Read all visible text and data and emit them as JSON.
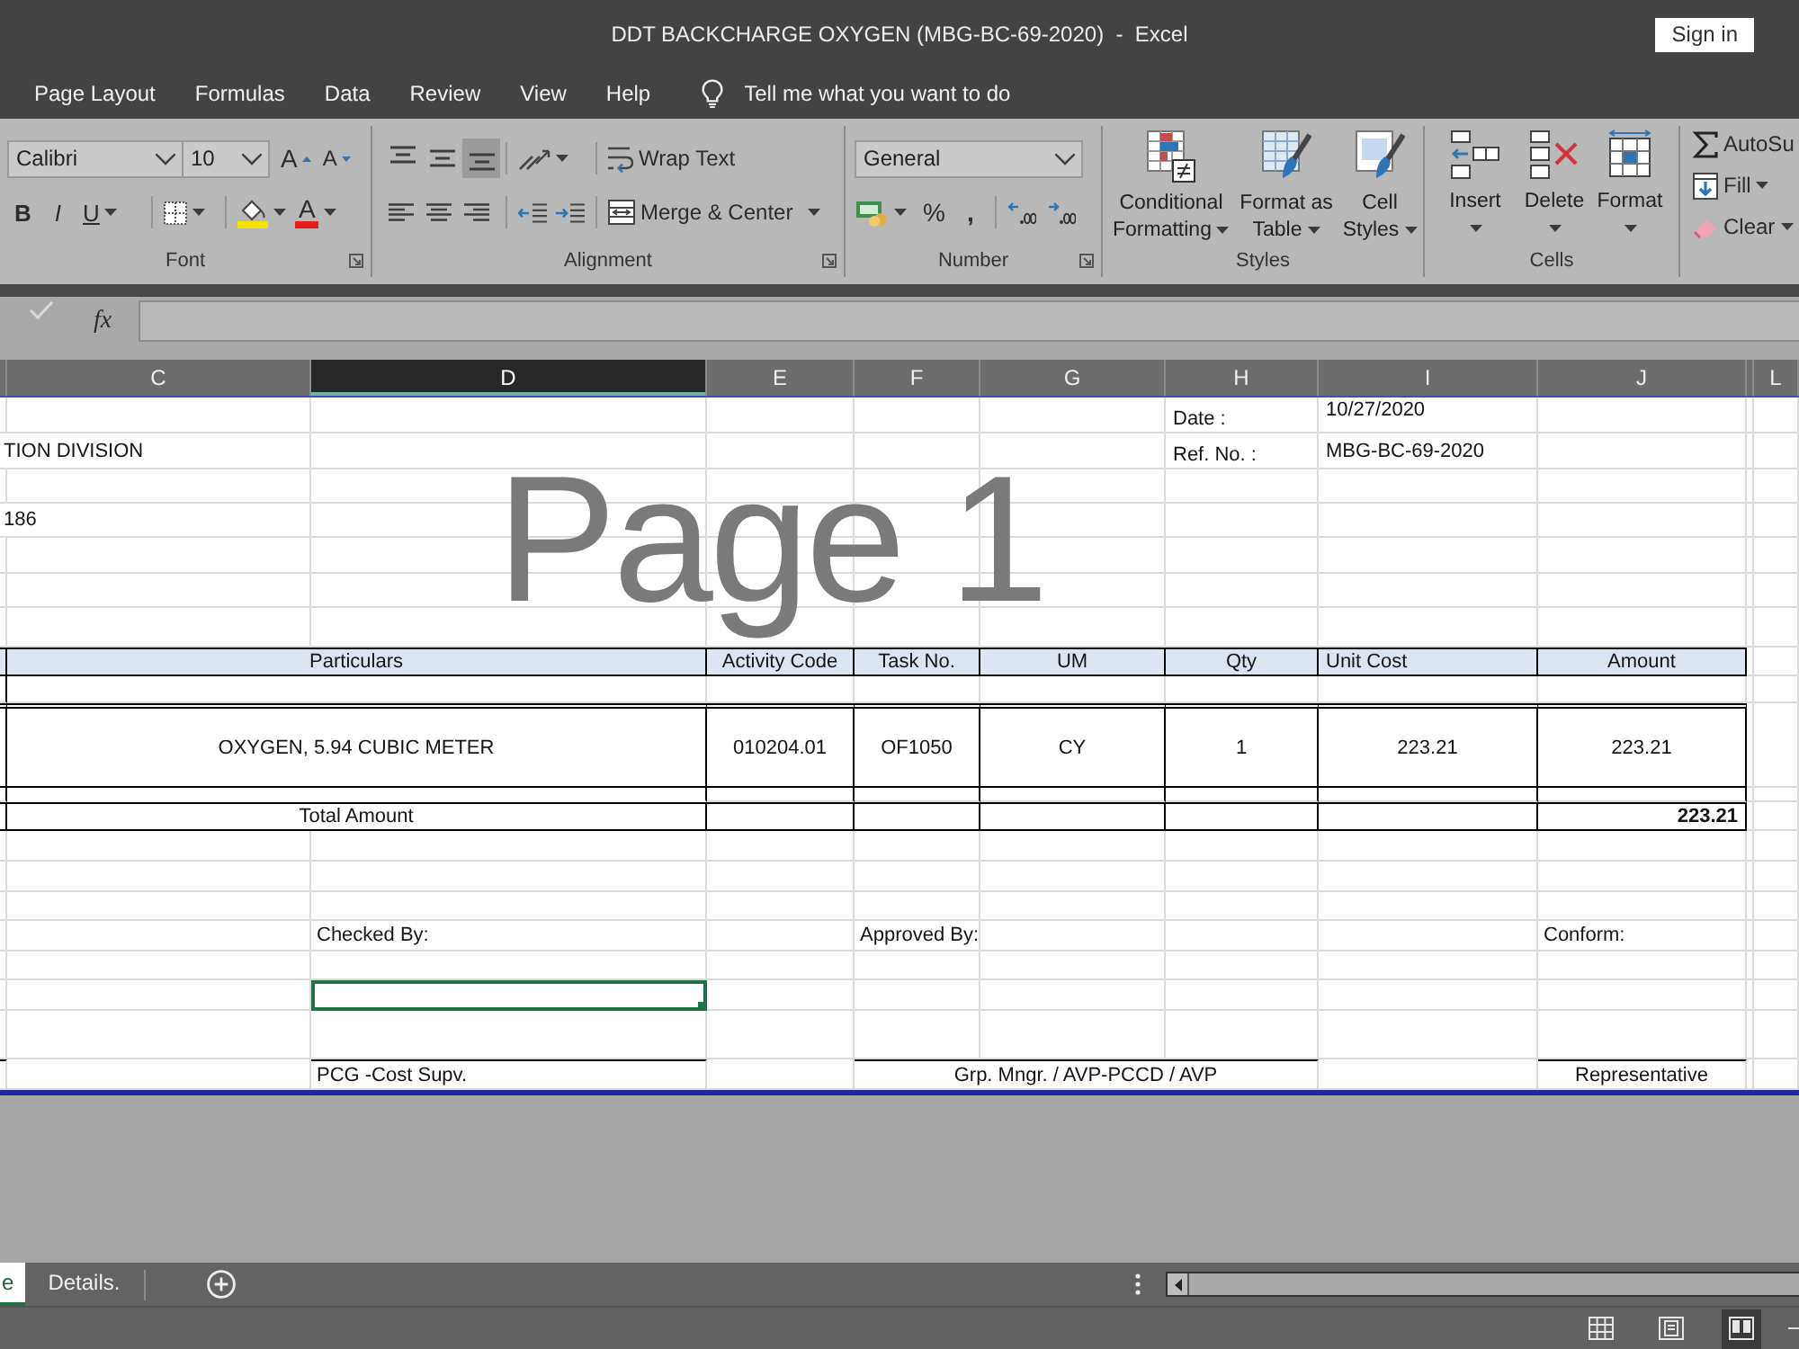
{
  "window": {
    "title": "DDT BACKCHARGE OXYGEN (MBG-BC-69-2020)  -  Excel",
    "sign_in": "Sign in"
  },
  "menu_tabs": [
    "Page Layout",
    "Formulas",
    "Data",
    "Review",
    "View",
    "Help"
  ],
  "tell_me": {
    "placeholder": "Tell me what you want to do"
  },
  "ribbon": {
    "font": {
      "label": "Font",
      "font_name": "Calibri",
      "font_size": "10",
      "grow": "A",
      "shrink": "A",
      "bold": "B",
      "italic": "I",
      "underline": "U",
      "font_color": "A"
    },
    "alignment": {
      "label": "Alignment",
      "vertical": [
        {
          "kind": "top",
          "selected": false
        },
        {
          "kind": "middle",
          "selected": false
        },
        {
          "kind": "bottom",
          "selected": true
        }
      ],
      "horizontal": [
        {
          "kind": "left",
          "selected": false
        },
        {
          "kind": "center",
          "selected": false
        },
        {
          "kind": "right",
          "selected": false
        }
      ],
      "wrap_text": "Wrap Text",
      "merge": "Merge & Center"
    },
    "number": {
      "label": "Number",
      "format": "General",
      "percent": "%",
      "comma": ","
    },
    "styles": {
      "label": "Styles",
      "buttons": [
        {
          "kind": "conditional_formatting",
          "label": "Conditional Formatting"
        },
        {
          "kind": "format_as_table",
          "label": "Format as Table"
        },
        {
          "kind": "cell_styles",
          "label": "Cell Styles"
        }
      ]
    },
    "cells": {
      "label": "Cells",
      "buttons": [
        {
          "kind": "insert",
          "label": "Insert"
        },
        {
          "kind": "delete",
          "label": "Delete"
        },
        {
          "kind": "format",
          "label": "Format"
        }
      ]
    },
    "editing": {
      "buttons": [
        {
          "kind": "autosum",
          "label": "AutoSu"
        },
        {
          "kind": "fill",
          "label": "Fill"
        },
        {
          "kind": "clear",
          "label": "Clear"
        }
      ]
    }
  },
  "formula_bar": {
    "function_button": "fx"
  },
  "column_headers": [
    {
      "label": "C",
      "selected": false
    },
    {
      "label": "D",
      "selected": true
    },
    {
      "label": "E",
      "selected": false
    },
    {
      "label": "F",
      "selected": false
    },
    {
      "label": "G",
      "selected": false
    },
    {
      "label": "H",
      "selected": false
    },
    {
      "label": "I",
      "selected": false
    },
    {
      "label": "J",
      "selected": false
    },
    {
      "label": "L",
      "selected": false
    }
  ],
  "sheet": {
    "heading_fragments": [
      "TION DIVISION",
      "186"
    ],
    "document_info": [
      {
        "label": "Date :",
        "value": "10/27/2020"
      },
      {
        "label": "Ref. No. :",
        "value": "MBG-BC-69-2020"
      }
    ],
    "table": {
      "columns": [
        "Particulars",
        "Activity Code",
        "Task No.",
        "UM",
        "Qty",
        "Unit Cost",
        "Amount"
      ],
      "rows": [
        [
          "OXYGEN, 5.94 CUBIC METER",
          "010204.01",
          "OF1050",
          "CY",
          "1",
          "223.21",
          "223.21"
        ]
      ],
      "total": {
        "label": "Total Amount",
        "amount": "223.21"
      }
    },
    "signatures": [
      {
        "title": "Checked By:",
        "role": "PCG -Cost Supv."
      },
      {
        "title": "Approved By:",
        "role": "Grp. Mngr. / AVP-PCCD / AVP"
      },
      {
        "title": "Conform:",
        "role": "Representative"
      }
    ],
    "page_label": "Page 1"
  },
  "sheet_tabs": [
    {
      "label": "e",
      "selected": true
    },
    {
      "label": "Details.",
      "selected": false
    }
  ],
  "view_buttons": [
    {
      "kind": "normal",
      "selected": false
    },
    {
      "kind": "page_layout",
      "selected": false
    },
    {
      "kind": "page_break_preview",
      "selected": true
    }
  ]
}
